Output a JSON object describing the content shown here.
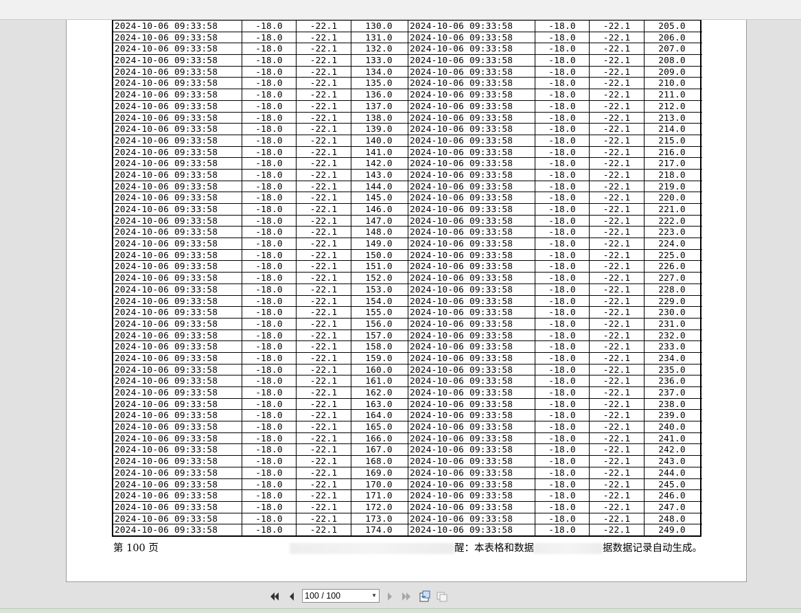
{
  "pager": {
    "current": "100 / 100"
  },
  "footer": {
    "page_label": "第 100 页",
    "notice_visible_1": "醒：本表格和数据",
    "notice_visible_2": "据数据记录自动生成。"
  },
  "icons": {
    "first": "first-page-icon",
    "prev": "prev-page-icon",
    "next": "next-page-icon",
    "last": "last-page-icon",
    "export": "export-icon",
    "pages": "multi-page-icon"
  },
  "table": {
    "timestamp": "2024-10-06 09:33:58",
    "col2": "-18.0",
    "col3": "-22.1",
    "left_values": [
      "130.0",
      "131.0",
      "132.0",
      "133.0",
      "134.0",
      "135.0",
      "136.0",
      "137.0",
      "138.0",
      "139.0",
      "140.0",
      "141.0",
      "142.0",
      "143.0",
      "144.0",
      "145.0",
      "146.0",
      "147.0",
      "148.0",
      "149.0",
      "150.0",
      "151.0",
      "152.0",
      "153.0",
      "154.0",
      "155.0",
      "156.0",
      "157.0",
      "158.0",
      "159.0",
      "160.0",
      "161.0",
      "162.0",
      "163.0",
      "164.0",
      "165.0",
      "166.0",
      "167.0",
      "168.0",
      "169.0",
      "170.0",
      "171.0",
      "172.0",
      "173.0",
      "174.0"
    ],
    "right_values": [
      "205.0",
      "206.0",
      "207.0",
      "208.0",
      "209.0",
      "210.0",
      "211.0",
      "212.0",
      "213.0",
      "214.0",
      "215.0",
      "216.0",
      "217.0",
      "218.0",
      "219.0",
      "220.0",
      "221.0",
      "222.0",
      "223.0",
      "224.0",
      "225.0",
      "226.0",
      "227.0",
      "228.0",
      "229.0",
      "230.0",
      "231.0",
      "232.0",
      "233.0",
      "234.0",
      "235.0",
      "236.0",
      "237.0",
      "238.0",
      "239.0",
      "240.0",
      "241.0",
      "242.0",
      "243.0",
      "244.0",
      "245.0",
      "246.0",
      "247.0",
      "248.0",
      "249.0"
    ]
  }
}
